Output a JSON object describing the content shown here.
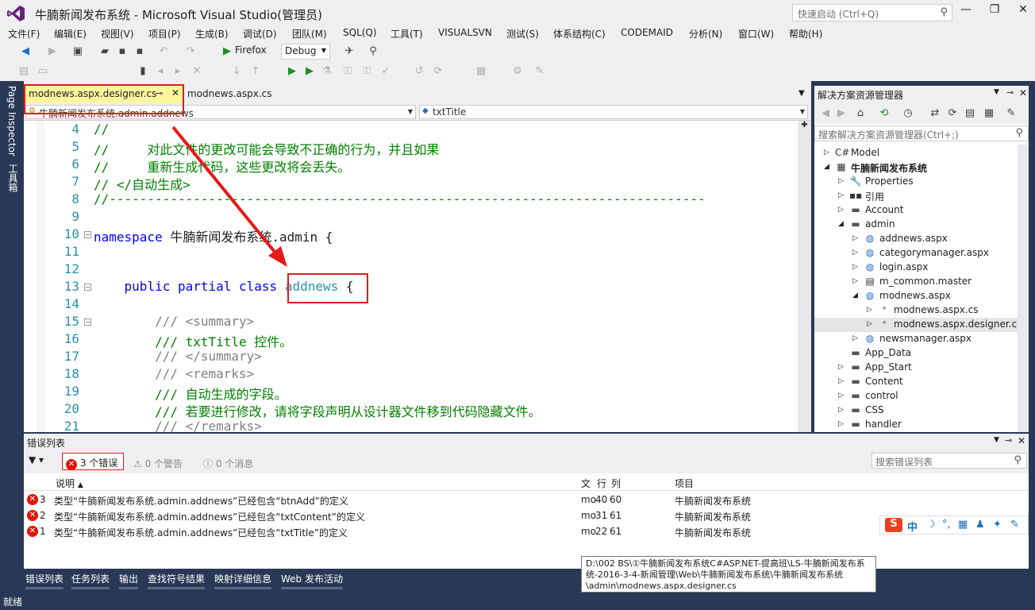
{
  "window": {
    "title": "牛腩新闻发布系统 - Microsoft Visual Studio(管理员)",
    "quick_launch_placeholder": "快速启动 (Ctrl+Q)"
  },
  "menu": [
    "文件(F)",
    "编辑(E)",
    "视图(V)",
    "项目(P)",
    "生成(B)",
    "调试(D)",
    "团队(M)",
    "SQL(Q)",
    "工具(T)",
    "VISUALSVN",
    "测试(S)",
    "体系结构(C)",
    "CODEMAID",
    "分析(N)",
    "窗口(W)",
    "帮助(H)"
  ],
  "toolbar": {
    "browser": "Firefox",
    "config": "Debug"
  },
  "left_strip": {
    "page_inspector": "Page Inspector",
    "toolbox": "工具箱"
  },
  "tabs": {
    "active": "modnews.aspx.designer.cs",
    "inactive": "modnews.aspx.cs"
  },
  "navbar": {
    "left": "牛腩新闻发布系统.admin.addnews",
    "right": "txtTitle"
  },
  "editor": {
    "lines": [
      {
        "n": "4",
        "text": "//"
      },
      {
        "n": "5",
        "text": "//     对此文件的更改可能会导致不正确的行为，并且如果"
      },
      {
        "n": "6",
        "text": "//     重新生成代码，这些更改将会丢失。"
      },
      {
        "n": "7",
        "text": "// </自动生成>"
      },
      {
        "n": "8",
        "text": "//------------------------------------------------------------------------------"
      },
      {
        "n": "9",
        "text": ""
      },
      {
        "n": "10",
        "kw": "namespace",
        "rest": " 牛腩新闻发布系统.admin {"
      },
      {
        "n": "11",
        "text": ""
      },
      {
        "n": "12",
        "text": ""
      },
      {
        "n": "13",
        "kw": "    public partial class ",
        "type": "addnews",
        "rest": " {"
      },
      {
        "n": "14",
        "text": ""
      },
      {
        "n": "15",
        "xd": "        /// <summary>",
        "rest": ""
      },
      {
        "n": "16",
        "cm": "        /// txtTitle 控件。"
      },
      {
        "n": "17",
        "xd": "        /// </summary>"
      },
      {
        "n": "18",
        "xd": "        /// <remarks>"
      },
      {
        "n": "19",
        "cm": "        /// 自动生成的字段。"
      },
      {
        "n": "20",
        "cm": "        /// 若要进行修改，请将字段声明从设计器文件移到代码隐藏文件。"
      },
      {
        "n": "21",
        "xd": "        /// </remarks>"
      }
    ]
  },
  "solution_explorer": {
    "title": "解决方案资源管理器",
    "search_placeholder": "搜索解决方案资源管理器(Ctrl+;)",
    "items": [
      {
        "label": "Model",
        "icon": "csharp-project-icon",
        "glyph": "C#",
        "bold": false
      },
      {
        "label": "牛腩新闻发布系统",
        "icon": "web-project-icon",
        "glyph": "▦",
        "bold": true
      },
      {
        "label": "Properties",
        "icon": "wrench-icon",
        "glyph": "🔧",
        "bold": false
      },
      {
        "label": "引用",
        "icon": "references-icon",
        "glyph": "▪▪",
        "bold": false
      },
      {
        "label": "Account",
        "icon": "folder-icon",
        "glyph": "▬",
        "bold": false
      },
      {
        "label": "admin",
        "icon": "folder-icon",
        "glyph": "▬",
        "bold": false
      },
      {
        "label": "addnews.aspx",
        "icon": "aspx-file-icon",
        "glyph": "◍",
        "bold": false
      },
      {
        "label": "categorymanager.aspx",
        "icon": "aspx-file-icon",
        "glyph": "◍",
        "bold": false
      },
      {
        "label": "login.aspx",
        "icon": "aspx-file-icon",
        "glyph": "◍",
        "bold": false
      },
      {
        "label": "m_common.master",
        "icon": "master-file-icon",
        "glyph": "▤",
        "bold": false
      },
      {
        "label": "modnews.aspx",
        "icon": "aspx-file-icon",
        "glyph": "◍",
        "bold": false
      },
      {
        "label": "modnews.aspx.cs",
        "icon": "cs-file-icon",
        "glyph": "⁺",
        "bold": false
      },
      {
        "label": "modnews.aspx.designer.c",
        "icon": "cs-file-icon",
        "glyph": "⁺",
        "bold": false
      },
      {
        "label": "newsmanager.aspx",
        "icon": "aspx-file-icon",
        "glyph": "◍",
        "bold": false
      },
      {
        "label": "App_Data",
        "icon": "folder-icon",
        "glyph": "▬",
        "bold": false
      },
      {
        "label": "App_Start",
        "icon": "folder-icon",
        "glyph": "▬",
        "bold": false
      },
      {
        "label": "Content",
        "icon": "folder-icon",
        "glyph": "▬",
        "bold": false
      },
      {
        "label": "control",
        "icon": "folder-icon",
        "glyph": "▬",
        "bold": false
      },
      {
        "label": "CSS",
        "icon": "folder-icon",
        "glyph": "▬",
        "bold": false
      },
      {
        "label": "handler",
        "icon": "folder-icon",
        "glyph": "▬",
        "bold": false
      }
    ]
  },
  "error_list": {
    "title": "错误列表",
    "errors_btn": "3 个错误",
    "warnings_btn": "0 个警告",
    "messages_btn": "0 个消息",
    "search_placeholder": "搜索错误列表",
    "columns": {
      "desc": "说明",
      "file": "文",
      "line": "行",
      "col": "列",
      "project": "项目"
    },
    "rows": [
      {
        "num": "3",
        "desc": "类型“牛腩新闻发布系统.admin.addnews”已经包含“btnAdd”的定义",
        "file": "mo",
        "line": "40",
        "col": "60",
        "project": "牛腩新闻发布系统"
      },
      {
        "num": "2",
        "desc": "类型“牛腩新闻发布系统.admin.addnews”已经包含“txtContent”的定义",
        "file": "mo",
        "line": "31",
        "col": "61",
        "project": "牛腩新闻发布系统"
      },
      {
        "num": "1",
        "desc": "类型“牛腩新闻发布系统.admin.addnews”已经包含“txtTitle”的定义",
        "file": "mo",
        "line": "22",
        "col": "61",
        "project": "牛腩新闻发布系统"
      }
    ]
  },
  "bottom_tabs": [
    "错误列表",
    "任务列表",
    "输出",
    "查找符号结果",
    "映射详细信息",
    "Web 发布活动"
  ],
  "status": "就绪",
  "tooltip": "D:\\002 BS\\①牛腩新闻发布系统C#ASP.NET-提高班\\LS-牛腩新闻发布系统-2016-3-4-新闻管理\\Web\\牛腩新闻发布系统\\牛腩新闻发布系统\\admin\\modnews.aspx.designer.cs",
  "ime": {
    "lang": "中"
  },
  "colors": {
    "accent": "#e41a1a",
    "frame": "#293955",
    "tab_active": "#fff59d"
  }
}
